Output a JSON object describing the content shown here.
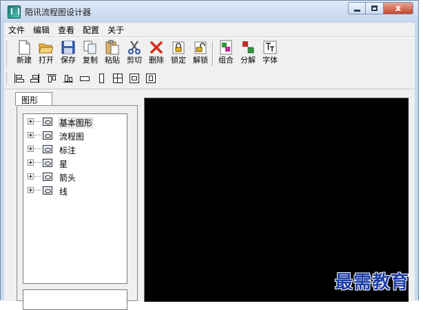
{
  "window": {
    "title": "陌讯流程图设计器",
    "close_glyph": "x"
  },
  "menu": [
    "文件",
    "编辑",
    "查看",
    "配置",
    "关于"
  ],
  "toolbar": {
    "buttons": [
      {
        "label": "新建",
        "icon": "new-file-icon"
      },
      {
        "label": "打开",
        "icon": "open-folder-icon"
      },
      {
        "label": "保存",
        "icon": "save-disk-icon"
      },
      {
        "label": "复制",
        "icon": "copy-icon"
      },
      {
        "label": "粘贴",
        "icon": "paste-icon"
      },
      {
        "label": "剪切",
        "icon": "scissors-icon"
      },
      {
        "label": "删除",
        "icon": "delete-x-icon"
      },
      {
        "label": "锁定",
        "icon": "lock-icon"
      },
      {
        "label": "解锁",
        "icon": "unlock-icon"
      },
      {
        "label": "组合",
        "icon": "group-icon"
      },
      {
        "label": "分解",
        "icon": "ungroup-icon"
      },
      {
        "label": "字体",
        "icon": "font-icon"
      }
    ]
  },
  "align_toolbar": [
    "align-left-icon",
    "align-right-icon",
    "align-top-icon",
    "align-bottom-icon",
    "same-width-icon",
    "same-height-icon",
    "same-size-icon",
    "center-horizontal-icon",
    "center-vertical-icon"
  ],
  "panel": {
    "tab": "图形",
    "tree": [
      "基本图形",
      "流程图",
      "标注",
      "星",
      "箭头",
      "线"
    ]
  },
  "watermark": "最需教育",
  "colors": {
    "canvas": "#000000",
    "watermark": "#1f3fa8",
    "close_button": "#c4452c",
    "chrome": "#c9d9ee"
  }
}
